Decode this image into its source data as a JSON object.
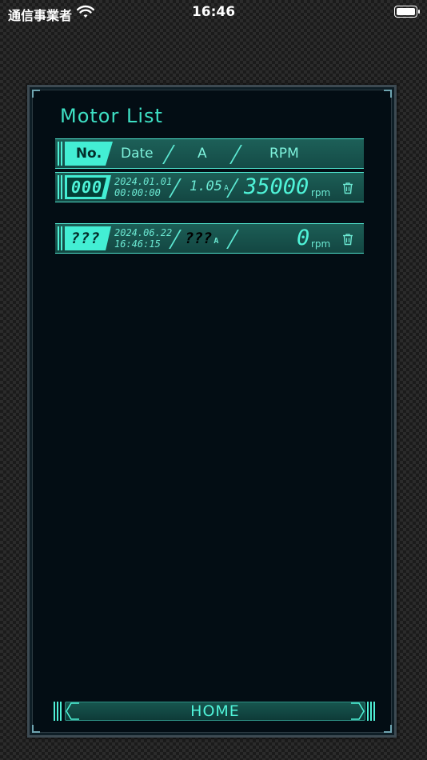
{
  "status_bar": {
    "carrier": "通信事業者",
    "time": "16:46"
  },
  "page": {
    "title": "Motor List"
  },
  "table": {
    "headers": {
      "no": "No.",
      "date": "Date",
      "amp": "A",
      "rpm": "RPM"
    },
    "rows": [
      {
        "no": "000",
        "date_line1": "2024.01.01",
        "date_line2": "00:00:00",
        "amp": "1.05",
        "amp_unit": "A",
        "rpm": "35000",
        "rpm_unit": "rpm"
      },
      {
        "no": "???",
        "date_line1": "2024.06.22",
        "date_line2": "16:46:15",
        "amp": "???",
        "amp_unit": "A",
        "rpm": "0",
        "rpm_unit": "rpm"
      }
    ]
  },
  "footer": {
    "home_label": "HOME"
  },
  "colors": {
    "accent": "#43eed4",
    "panel_bg": "#030d14",
    "row_bg": "#1c5e56"
  },
  "icons": {
    "wifi": "wifi-icon",
    "battery": "battery-icon",
    "trash": "trash-icon"
  }
}
